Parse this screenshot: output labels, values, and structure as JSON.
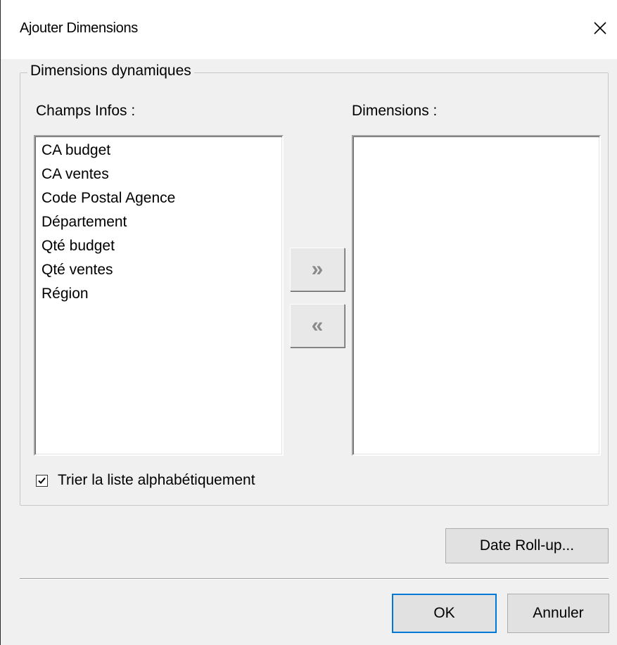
{
  "window": {
    "title": "Ajouter Dimensions",
    "close_icon": "close-icon"
  },
  "group": {
    "title": "Dimensions dynamiques"
  },
  "source_list": {
    "label": "Champs Infos :",
    "items": [
      {
        "label": "CA budget"
      },
      {
        "label": "CA ventes"
      },
      {
        "label": "Code Postal Agence"
      },
      {
        "label": "Département"
      },
      {
        "label": "Qté budget"
      },
      {
        "label": "Qté ventes"
      },
      {
        "label": "Région"
      }
    ]
  },
  "target_list": {
    "label": "Dimensions :",
    "items": []
  },
  "transfer": {
    "add_label": "»",
    "remove_label": "«",
    "add_icon": "double-chevron-right-icon",
    "remove_icon": "double-chevron-left-icon"
  },
  "sort_option": {
    "label": "Trier la liste alphabétiquement",
    "checked": true
  },
  "buttons": {
    "date_rollup": "Date Roll-up...",
    "ok": "OK",
    "cancel": "Annuler"
  },
  "colors": {
    "dialog_bg": "#f0f0f0",
    "title_bg": "#ffffff",
    "default_button_border": "#0078d7",
    "disabled_glyph": "#8a8a8a"
  }
}
